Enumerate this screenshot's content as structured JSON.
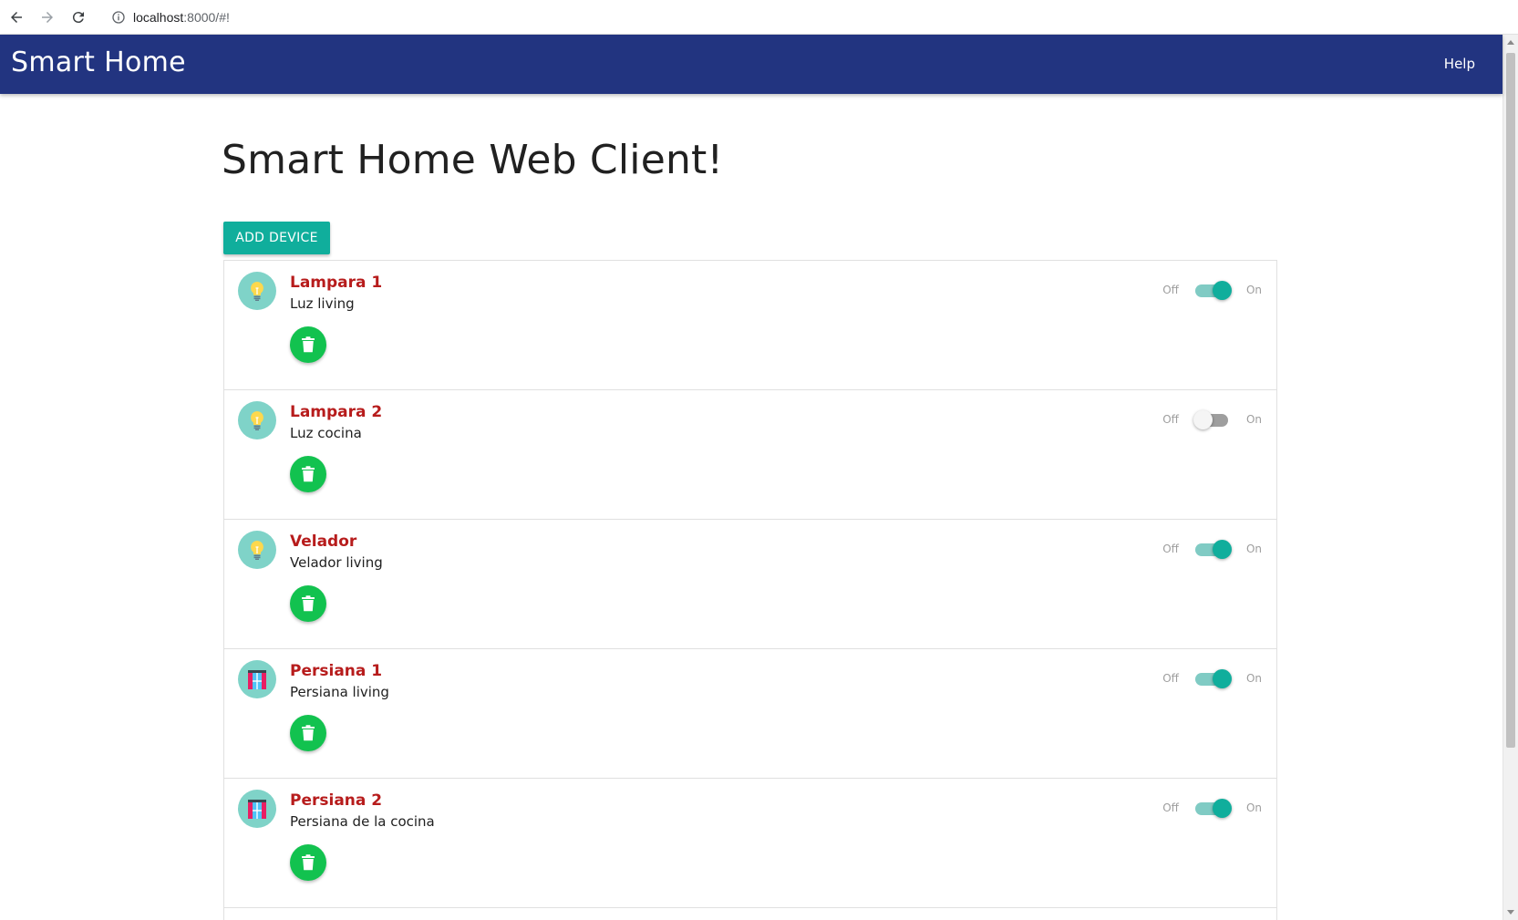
{
  "browser": {
    "url_host": "localhost",
    "url_path": ":8000/#!"
  },
  "navbar": {
    "brand": "Smart Home",
    "help_label": "Help"
  },
  "main": {
    "title": "Smart Home Web Client!",
    "add_device_label": "ADD DEVICE"
  },
  "colors": {
    "navbar": "#223480",
    "accent": "#10ae9c",
    "device_name": "#b71c1c",
    "delete_button": "#12c24f"
  },
  "devices": [
    {
      "name": "Lampara 1",
      "description": "Luz living",
      "icon": "lightbulb-icon",
      "state": true,
      "off_label": "Off",
      "on_label": "On"
    },
    {
      "name": "Lampara 2",
      "description": "Luz cocina",
      "icon": "lightbulb-icon",
      "state": false,
      "off_label": "Off",
      "on_label": "On"
    },
    {
      "name": "Velador",
      "description": "Velador living",
      "icon": "lightbulb-icon",
      "state": true,
      "off_label": "Off",
      "on_label": "On"
    },
    {
      "name": "Persiana 1",
      "description": "Persiana living",
      "icon": "window-blind-icon",
      "state": true,
      "off_label": "Off",
      "on_label": "On"
    },
    {
      "name": "Persiana 2",
      "description": "Persiana de la cocina",
      "icon": "window-blind-icon",
      "state": true,
      "off_label": "Off",
      "on_label": "On"
    }
  ]
}
